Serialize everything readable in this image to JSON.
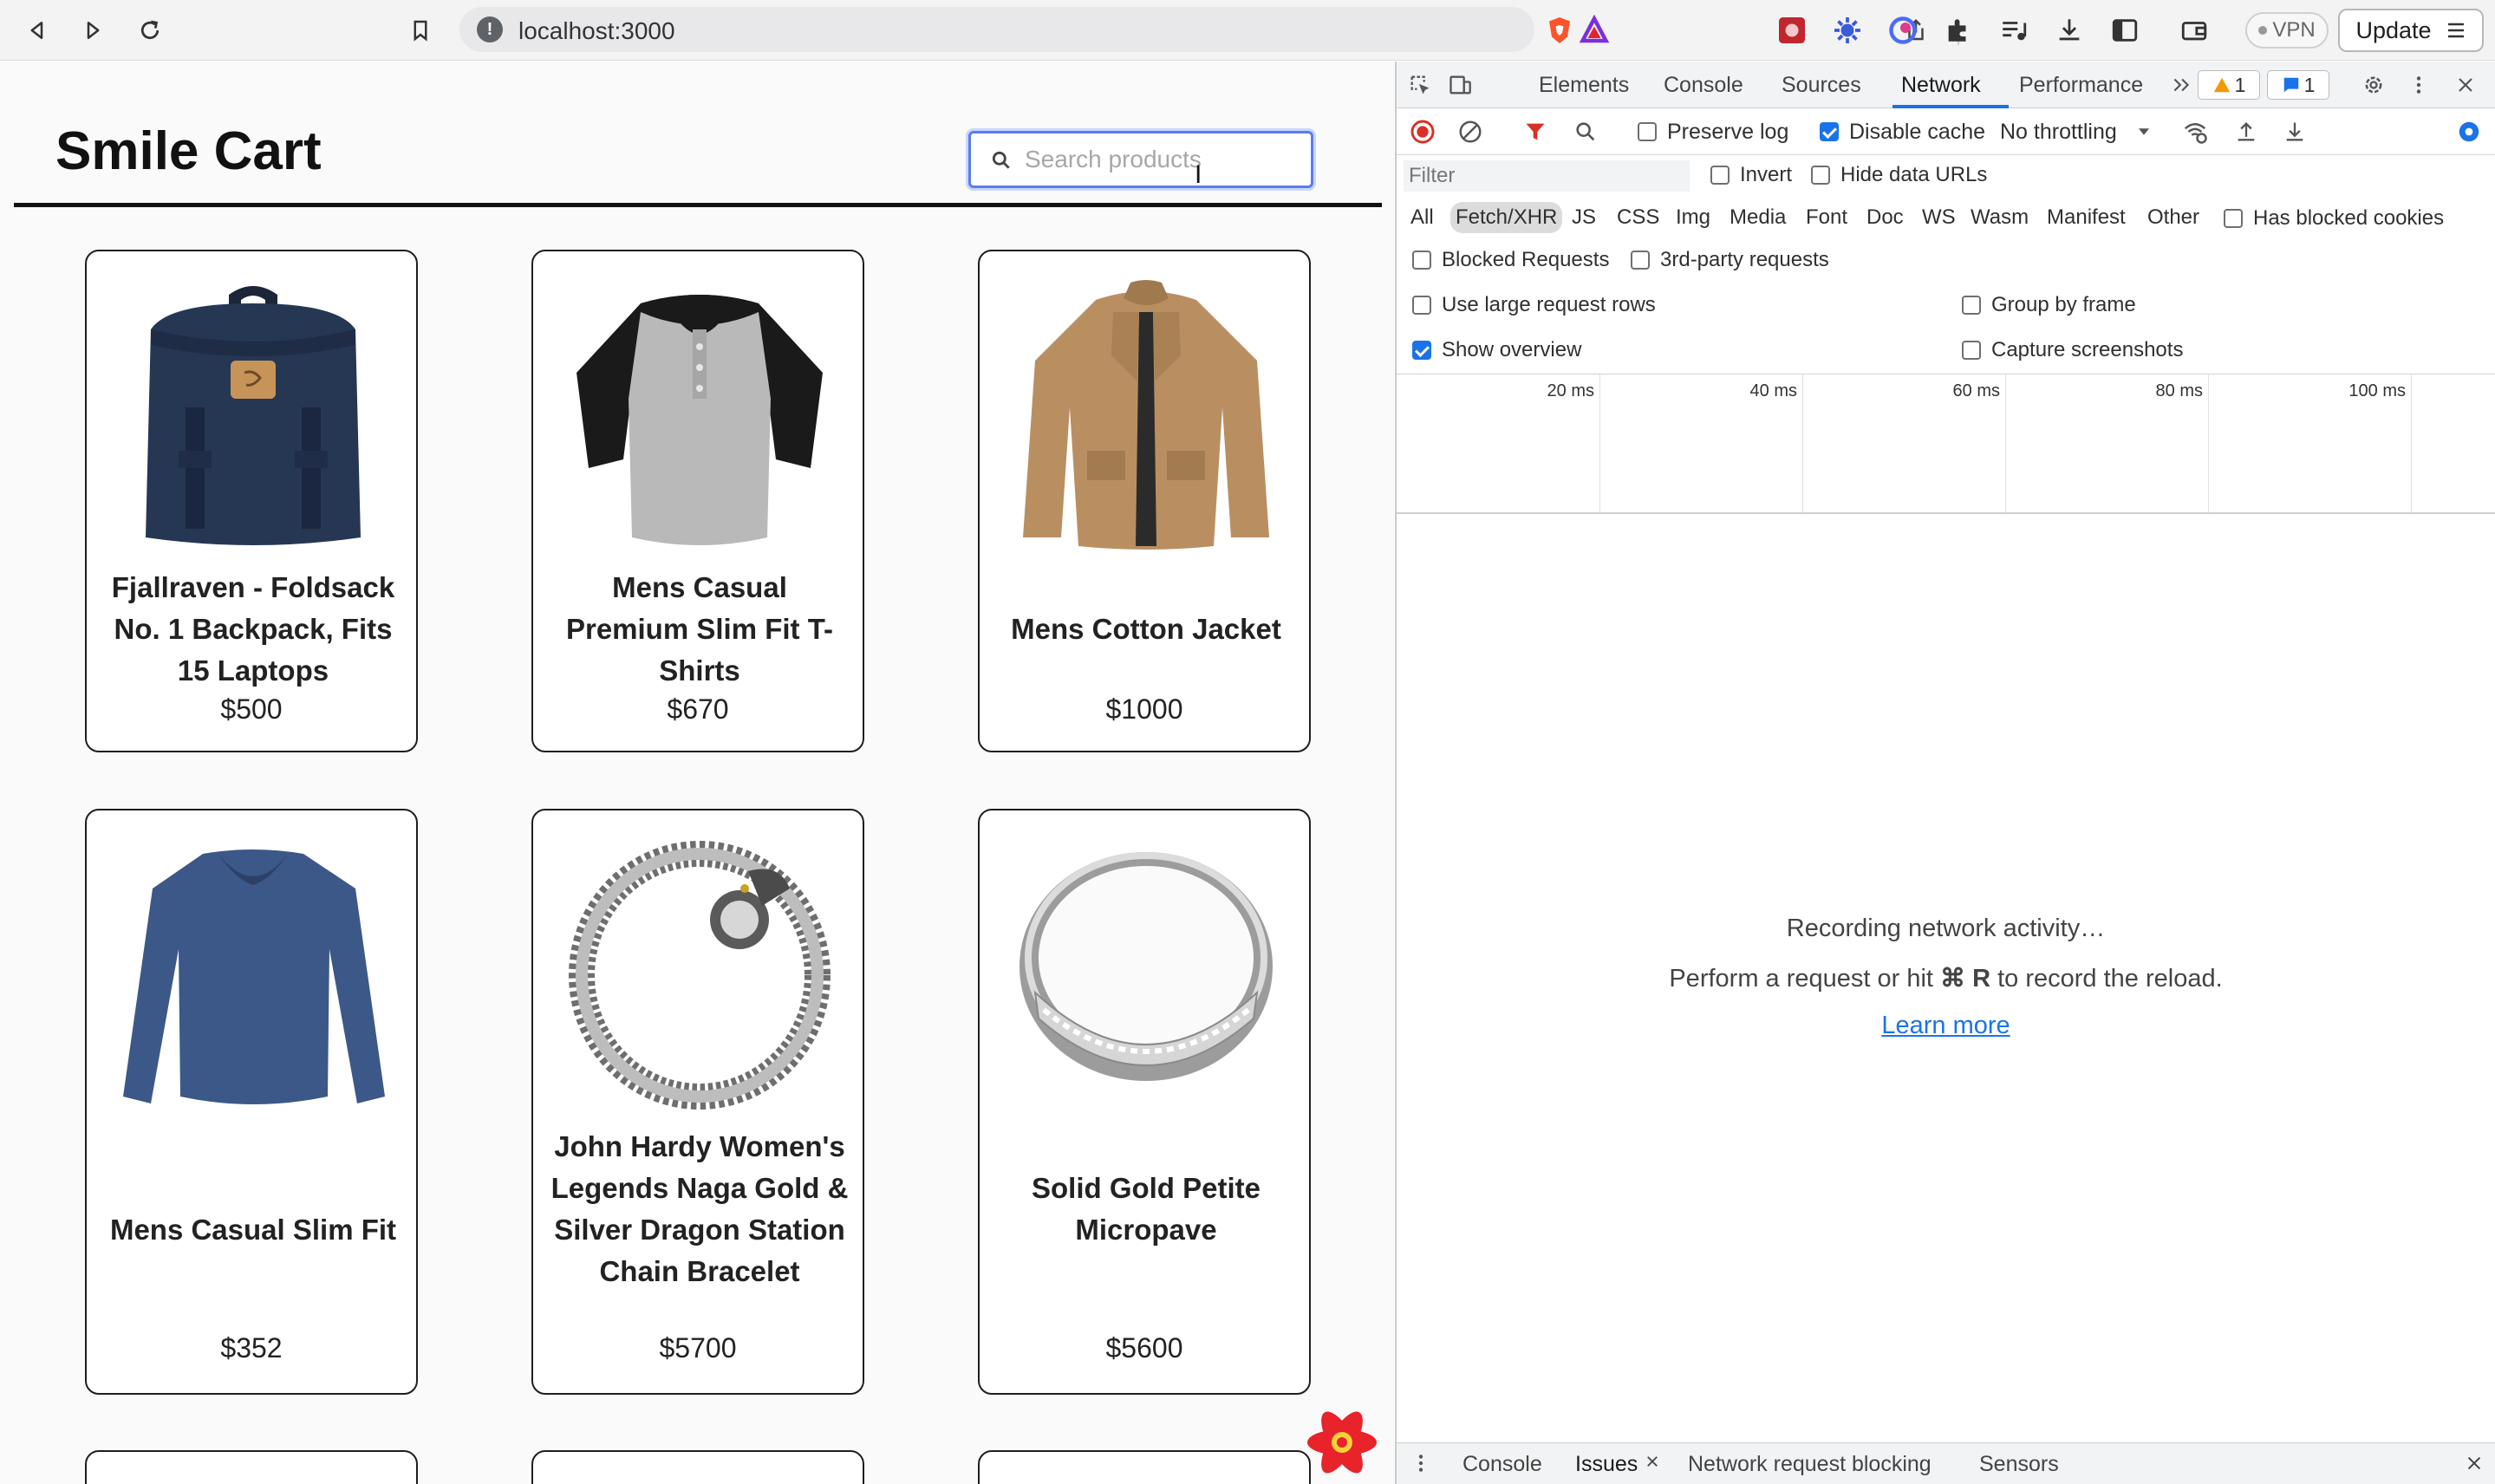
{
  "browser": {
    "url": "localhost:3000",
    "vpn_label": "VPN",
    "update_label": "Update"
  },
  "page": {
    "title": "Smile Cart",
    "search": {
      "placeholder": "Search products",
      "value": ""
    },
    "products": [
      {
        "name": "Fjallraven - Foldsack No. 1 Backpack, Fits 15 Laptops",
        "price": "$500",
        "icon": "backpack-image"
      },
      {
        "name": "Mens Casual Premium Slim Fit T-Shirts",
        "price": "$670",
        "icon": "tshirt-image"
      },
      {
        "name": "Mens Cotton Jacket",
        "price": "$1000",
        "icon": "jacket-image"
      },
      {
        "name": "Mens Casual Slim Fit",
        "price": "$352",
        "icon": "longsleeve-image"
      },
      {
        "name": "John Hardy Women's Legends Naga Gold & Silver Dragon Station Chain Bracelet",
        "price": "$5700",
        "icon": "bracelet-image"
      },
      {
        "name": "Solid Gold Petite Micropave",
        "price": "$5600",
        "icon": "ring-image"
      }
    ]
  },
  "devtools": {
    "tabs": [
      "Elements",
      "Console",
      "Sources",
      "Network",
      "Performance"
    ],
    "active_tab": "Network",
    "warnings_count": "1",
    "messages_count": "1",
    "toolbar": {
      "preserve_log": "Preserve log",
      "disable_cache": "Disable cache",
      "throttling": "No throttling"
    },
    "filter": {
      "placeholder": "Filter",
      "invert": "Invert",
      "hide_data_urls": "Hide data URLs"
    },
    "types": [
      "All",
      "Fetch/XHR",
      "JS",
      "CSS",
      "Img",
      "Media",
      "Font",
      "Doc",
      "WS",
      "Wasm",
      "Manifest",
      "Other"
    ],
    "selected_type": "Fetch/XHR",
    "has_blocked_cookies": "Has blocked cookies",
    "blocked_requests": "Blocked Requests",
    "third_party": "3rd-party requests",
    "use_large_rows": "Use large request rows",
    "group_by_frame": "Group by frame",
    "show_overview": "Show overview",
    "capture_screenshots": "Capture screenshots",
    "timeline_ticks": [
      "20 ms",
      "40 ms",
      "60 ms",
      "80 ms",
      "100 ms"
    ],
    "recording": {
      "line1": "Recording network activity…",
      "line2_prefix": "Perform a request or hit",
      "line2_key": "⌘ R",
      "line2_suffix": "to record the reload.",
      "learn_more": "Learn more"
    },
    "drawer_tabs": [
      "Console",
      "Issues",
      "Network request blocking",
      "Sensors"
    ]
  },
  "colors": {
    "accent": "#1a73e8",
    "search_focus": "#5c7cf0",
    "record_red": "#d93025",
    "react_red": "#e8232a"
  }
}
